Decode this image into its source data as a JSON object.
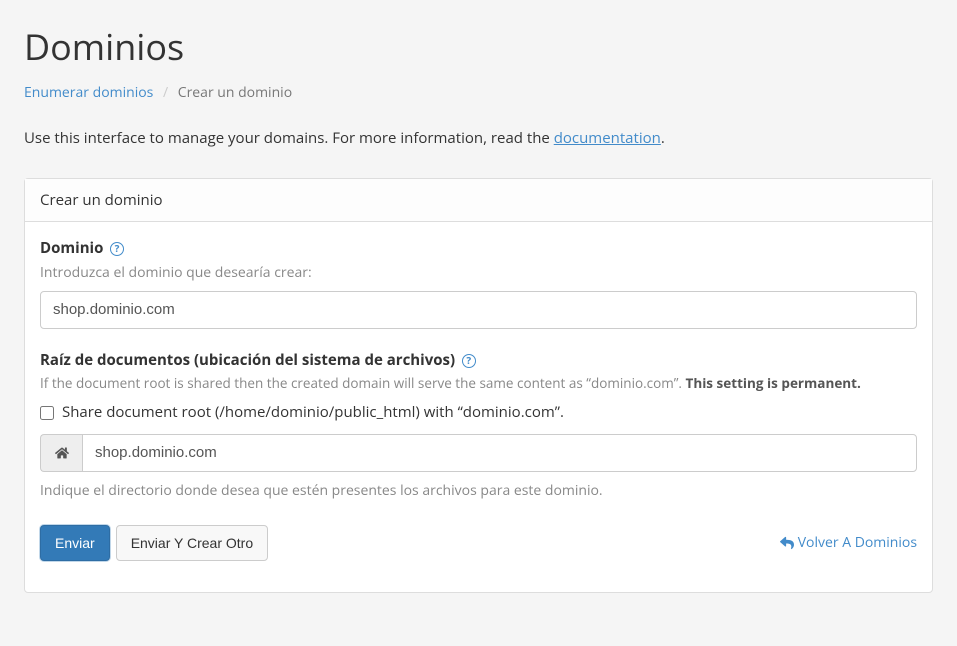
{
  "page": {
    "title": "Dominios"
  },
  "breadcrumb": {
    "list_label": "Enumerar dominios",
    "current": "Crear un dominio"
  },
  "intro": {
    "text_before": "Use this interface to manage your domains. For more information, read the ",
    "link": "documentation",
    "text_after": "."
  },
  "panel": {
    "heading": "Crear un dominio"
  },
  "form": {
    "domain": {
      "label": "Dominio",
      "help": "Introduzca el dominio que desearía crear:",
      "value": "shop.dominio.com"
    },
    "docroot": {
      "label": "Raíz de documentos (ubicación del sistema de archivos)",
      "help_before": "If the document root is shared then the created domain will serve the same content as “dominio.com”. ",
      "help_bold": "This setting is permanent.",
      "checkbox_label": "Share document root (/home/dominio/public_html) with “dominio.com”.",
      "path_value": "shop.dominio.com",
      "footer": "Indique el directorio donde desea que estén presentes los archivos para este dominio."
    }
  },
  "buttons": {
    "submit": "Enviar",
    "submit_another": "Enviar Y Crear Otro",
    "back": "Volver A Dominios"
  }
}
